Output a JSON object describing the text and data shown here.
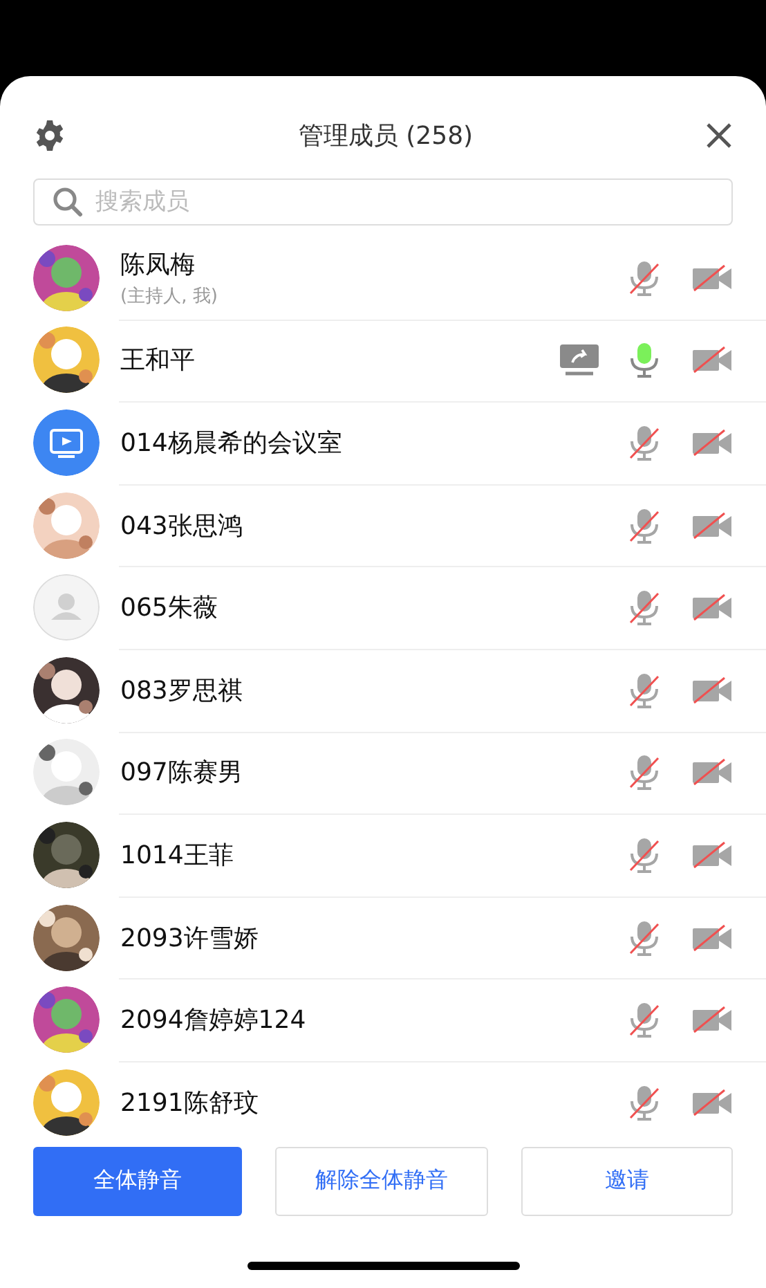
{
  "header": {
    "title": "管理成员 (258)"
  },
  "search": {
    "placeholder": "搜索成员"
  },
  "members": [
    {
      "name": "陈凤梅",
      "note": "(主持人, 我)",
      "kind": "picture",
      "sharing": false,
      "mic_on": false,
      "camera_on": false
    },
    {
      "name": "王和平",
      "kind": "picture",
      "sharing": true,
      "mic_on": true,
      "camera_on": false
    },
    {
      "name": "014杨晨希的会议室",
      "kind": "room",
      "sharing": false,
      "mic_on": false,
      "camera_on": false
    },
    {
      "name": "043张思鸿",
      "kind": "picture",
      "sharing": false,
      "mic_on": false,
      "camera_on": false
    },
    {
      "name": "065朱薇",
      "kind": "default",
      "sharing": false,
      "mic_on": false,
      "camera_on": false
    },
    {
      "name": "083罗思祺",
      "kind": "picture",
      "sharing": false,
      "mic_on": false,
      "camera_on": false
    },
    {
      "name": "097陈赛男",
      "kind": "picture",
      "sharing": false,
      "mic_on": false,
      "camera_on": false
    },
    {
      "name": "1014王菲",
      "kind": "picture",
      "sharing": false,
      "mic_on": false,
      "camera_on": false
    },
    {
      "name": "2093许雪娇",
      "kind": "picture",
      "sharing": false,
      "mic_on": false,
      "camera_on": false
    },
    {
      "name": "2094詹婷婷124",
      "kind": "picture",
      "sharing": false,
      "mic_on": false,
      "camera_on": false
    },
    {
      "name": "2191陈舒玟",
      "kind": "picture",
      "sharing": false,
      "mic_on": false,
      "camera_on": false
    }
  ],
  "buttons": [
    {
      "label": "全体静音",
      "kind": "primary"
    },
    {
      "label": "解除全体静音",
      "kind": "outline"
    },
    {
      "label": "邀请",
      "kind": "outline"
    }
  ]
}
